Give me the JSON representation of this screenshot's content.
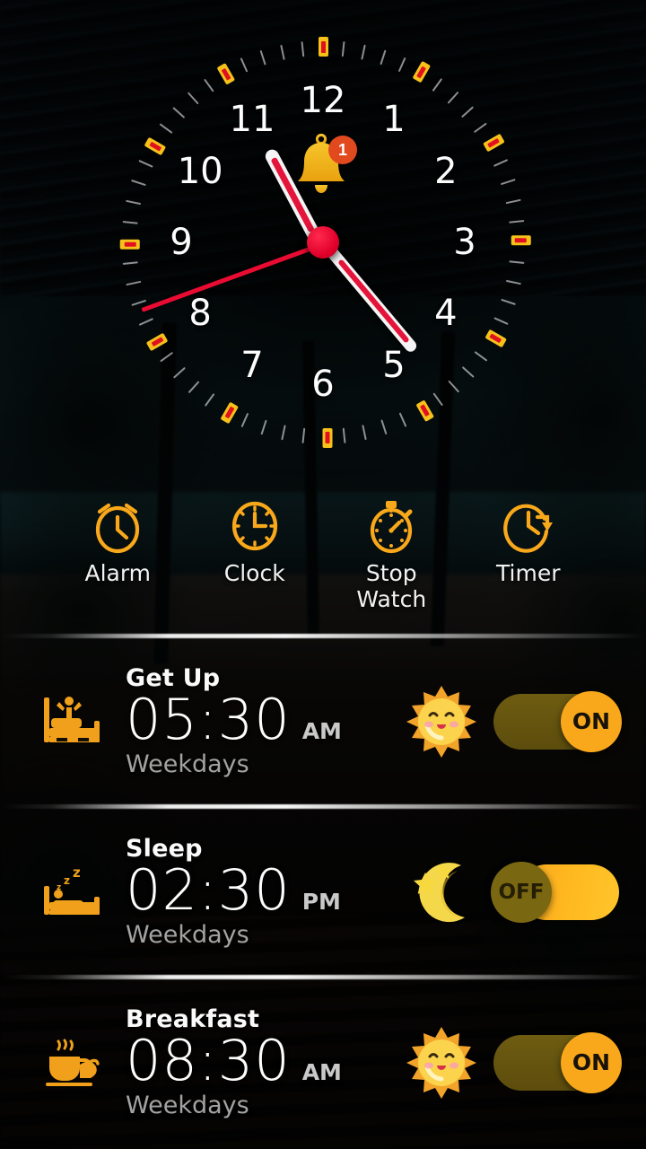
{
  "app": {
    "badge_count": "1",
    "bell_icon": "bell-icon"
  },
  "clock": {
    "numerals": [
      "12",
      "1",
      "2",
      "3",
      "4",
      "5",
      "6",
      "7",
      "8",
      "9",
      "10",
      "11"
    ],
    "hour_hand_deg": 242,
    "minute_hand_deg": 50,
    "second_hand_deg": 160,
    "marker_color": "#f6c21a",
    "marker_inner_color": "#e01020",
    "hand_accent_color": "#e4143a",
    "hub_color": "#e1002a"
  },
  "nav": {
    "items": [
      {
        "label": "Alarm",
        "icon": "alarm-clock-icon"
      },
      {
        "label": "Clock",
        "icon": "clock-icon"
      },
      {
        "label": "Stop Watch",
        "icon": "stopwatch-icon"
      },
      {
        "label": "Timer",
        "icon": "timer-icon"
      }
    ]
  },
  "alarms": [
    {
      "title": "Get Up",
      "time": "05:30",
      "meridiem": "AM",
      "days": "Weekdays",
      "icon": "wake-up-in-bed-icon",
      "weather_icon": "smiling-sun-icon",
      "toggle_state": "on",
      "toggle_label": "ON"
    },
    {
      "title": "Sleep",
      "time": "02:30",
      "meridiem": "PM",
      "days": "Weekdays",
      "icon": "sleeping-in-bed-icon",
      "weather_icon": "crescent-moon-stars-icon",
      "toggle_state": "off",
      "toggle_label": "OFF"
    },
    {
      "title": "Breakfast",
      "time": "08:30",
      "meridiem": "AM",
      "days": "Weekdays",
      "icon": "coffee-cup-teapot-icon",
      "weather_icon": "smiling-sun-icon",
      "toggle_state": "on",
      "toggle_label": "ON"
    }
  ],
  "colors": {
    "accent": "#f9a81b",
    "accent_deep": "#e8960f",
    "red": "#e4143a",
    "text_primary": "#fdfdfd",
    "text_muted": "#a3a3a3",
    "toggle_off_knob": "#7a6712"
  }
}
